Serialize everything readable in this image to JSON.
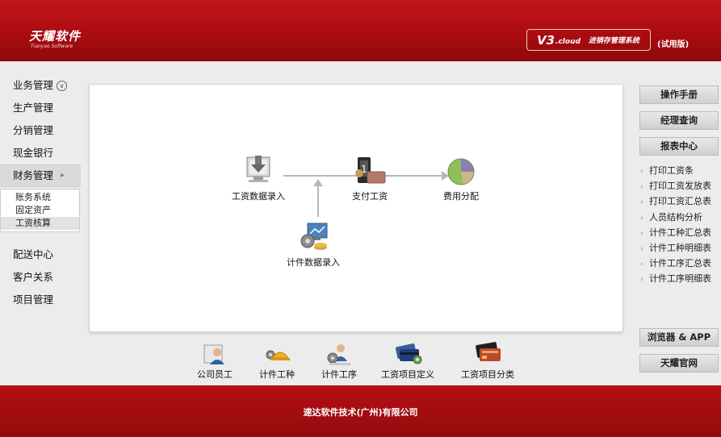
{
  "header": {
    "logo_cn": "天耀软件",
    "logo_en": "Tianyao Software",
    "version_main": "V3",
    "version_cloud": ".cloud",
    "system_name": "进销存管理系统",
    "trial": "(试用版)"
  },
  "sidebar": {
    "items": [
      {
        "label": "业务管理"
      },
      {
        "label": "生产管理"
      },
      {
        "label": "分销管理"
      },
      {
        "label": "现金银行"
      },
      {
        "label": "财务管理"
      },
      {
        "label": "配送中心"
      },
      {
        "label": "客户关系"
      },
      {
        "label": "项目管理"
      }
    ],
    "finance_sub": [
      {
        "label": "账务系统"
      },
      {
        "label": "固定资产"
      },
      {
        "label": "工资核算"
      }
    ]
  },
  "flow": {
    "salary_entry": "工资数据录入",
    "pay_salary": "支付工资",
    "cost_allocation": "费用分配",
    "piece_entry": "计件数据录入"
  },
  "toolbar": {
    "employee": "公司员工",
    "piece_type": "计件工种",
    "piece_process": "计件工序",
    "item_definition": "工资项目定义",
    "item_category": "工资项目分类"
  },
  "right": {
    "manual": "操作手册",
    "manager_query": "经理查询",
    "report_center": "报表中心",
    "reports": [
      {
        "label": "打印工资条"
      },
      {
        "label": "打印工资发放表"
      },
      {
        "label": "打印工资汇总表"
      },
      {
        "label": "人员结构分析"
      },
      {
        "label": "计件工种汇总表"
      },
      {
        "label": "计件工种明细表"
      },
      {
        "label": "计件工序汇总表"
      },
      {
        "label": "计件工序明细表"
      }
    ],
    "browser_app": "浏览器 & APP",
    "official_site": "天耀官网"
  },
  "footer": {
    "company": "速达软件技术(广州)有限公司"
  },
  "colors": {
    "brand_red": "#b3060c",
    "panel_bg": "#ffffff",
    "page_bg": "#ececec"
  }
}
